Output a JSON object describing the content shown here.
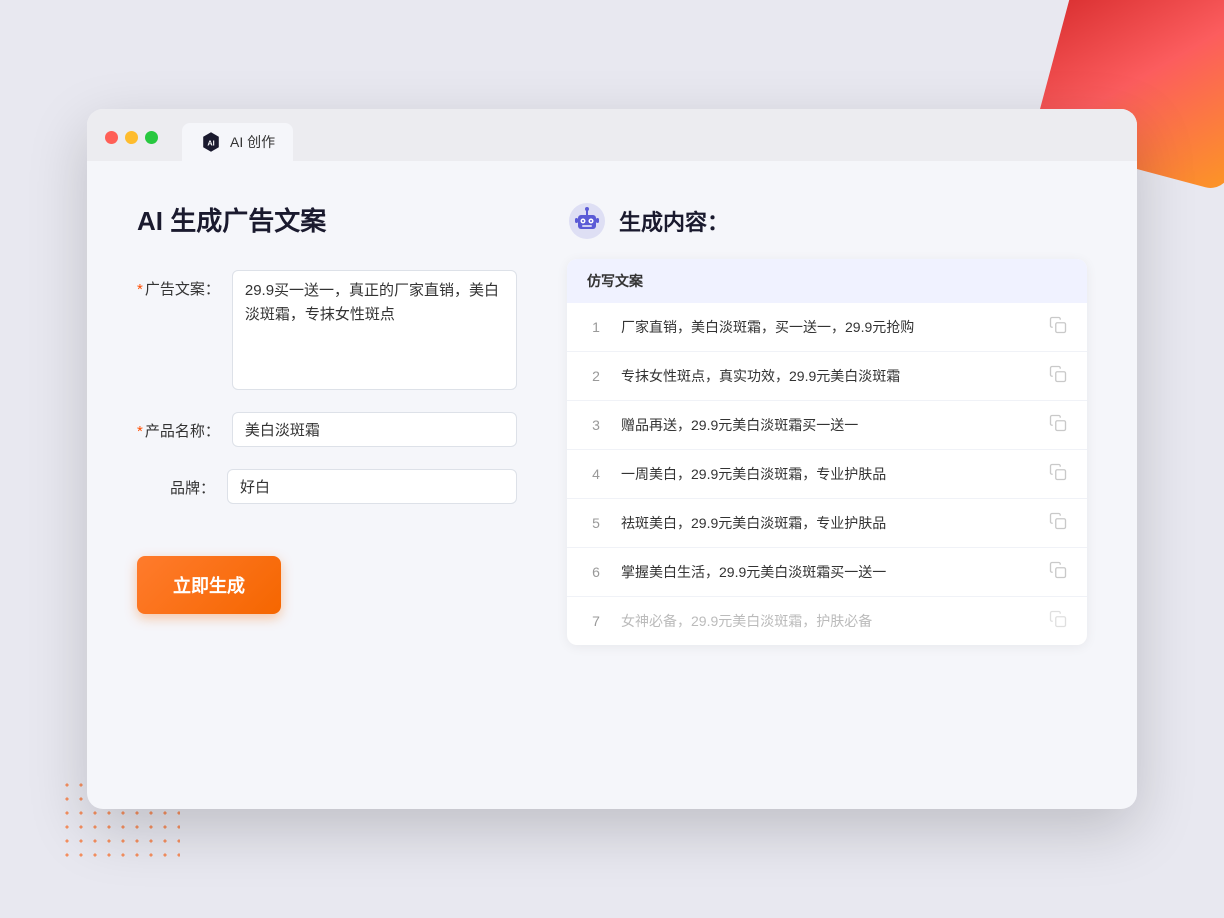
{
  "background": {
    "corner_color": "#cc2200"
  },
  "browser": {
    "tab_label": "AI 创作"
  },
  "page": {
    "title": "AI 生成广告文案"
  },
  "form": {
    "ad_copy_label": "广告文案：",
    "ad_copy_required": "*",
    "ad_copy_value": "29.9买一送一，真正的厂家直销，美白淡斑霜，专抹女性斑点",
    "product_name_label": "产品名称：",
    "product_name_required": "*",
    "product_name_value": "美白淡斑霜",
    "brand_label": "品牌：",
    "brand_value": "好白",
    "generate_button": "立即生成"
  },
  "results": {
    "header": "生成内容：",
    "column_header": "仿写文案",
    "items": [
      {
        "num": "1",
        "text": "厂家直销，美白淡斑霜，买一送一，29.9元抢购",
        "muted": false
      },
      {
        "num": "2",
        "text": "专抹女性斑点，真实功效，29.9元美白淡斑霜",
        "muted": false
      },
      {
        "num": "3",
        "text": "赠品再送，29.9元美白淡斑霜买一送一",
        "muted": false
      },
      {
        "num": "4",
        "text": "一周美白，29.9元美白淡斑霜，专业护肤品",
        "muted": false
      },
      {
        "num": "5",
        "text": "祛斑美白，29.9元美白淡斑霜，专业护肤品",
        "muted": false
      },
      {
        "num": "6",
        "text": "掌握美白生活，29.9元美白淡斑霜买一送一",
        "muted": false
      },
      {
        "num": "7",
        "text": "女神必备，29.9元美白淡斑霜，护肤必备",
        "muted": true
      }
    ]
  }
}
